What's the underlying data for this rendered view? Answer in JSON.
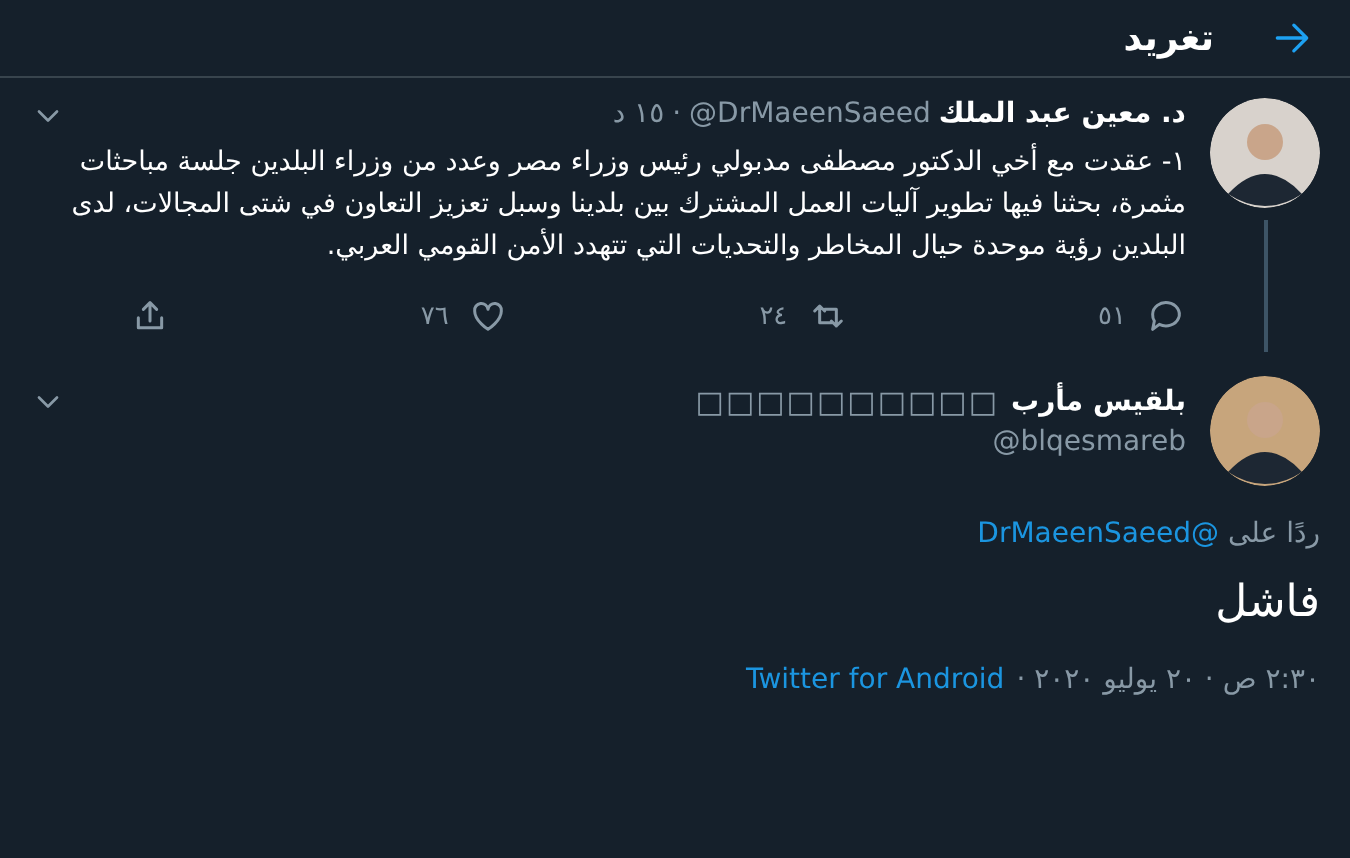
{
  "header": {
    "title": "تغريد"
  },
  "thread_tweet": {
    "name": "د. معين عبد الملك",
    "handle": "@DrMaeenSaeed",
    "separator": "·",
    "time": "١٥ د",
    "text": "١- عقدت مع أخي الدكتور مصطفى مدبولي رئيس وزراء مصر وعدد من وزراء البلدين جلسة مباحثات مثمرة، بحثنا فيها تطوير آليات العمل المشترك بين بلدينا وسبل تعزيز التعاون في شتى المجالات، لدى البلدين رؤية موحدة حيال المخاطر والتحديات التي تتهدد الأمن القومي العربي.",
    "stats": [
      {
        "kind": "reply",
        "count": "٥١"
      },
      {
        "kind": "retweet",
        "count": "٢٤"
      },
      {
        "kind": "like",
        "count": "٧٦"
      },
      {
        "kind": "share"
      }
    ]
  },
  "main_tweet": {
    "name": "بلقيس مأرب",
    "name_suffix": "□□□□□□□□□□",
    "handle": "@blqesmareb",
    "reply_label": "ردًا على",
    "reply_to": "@DrMaeenSaeed",
    "text": "فاشل",
    "date": "٢:٣٠ ص · ٢٠ يوليو ٢٠٢٠ ·",
    "source": "Twitter for Android"
  }
}
